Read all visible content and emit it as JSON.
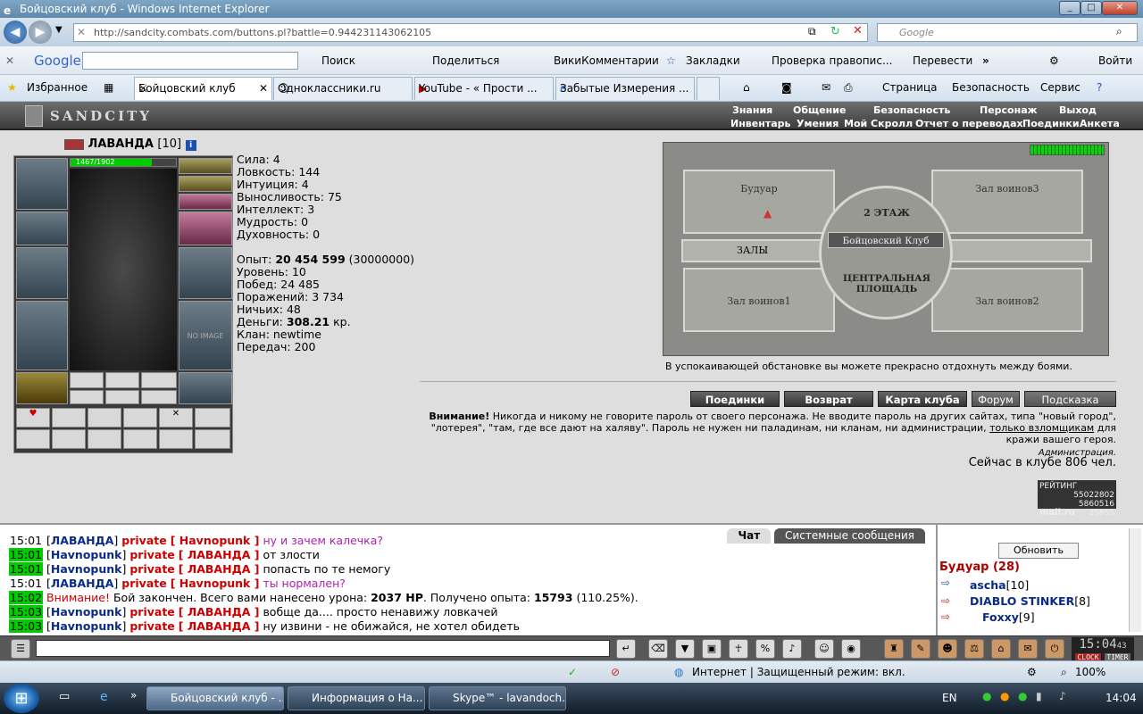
{
  "window": {
    "title": "Бойцовский клуб - Windows Internet Explorer"
  },
  "address": {
    "url": "http://sandcity.combats.com/buttons.pl?battle=0.944231143062105",
    "search_placeholder": "Google"
  },
  "google_toolbar": {
    "logo": "Google",
    "search": "Поиск",
    "share": "Поделиться",
    "wiki": "ВикиКомментарии",
    "bookmarks": "Закладки",
    "spell": "Проверка правопис...",
    "translate": "Перевести",
    "login": "Войти"
  },
  "favorites": {
    "label": "Избранное",
    "tabs": [
      "Бойцовский клуб",
      "Одноклассники.ru",
      "YouTube - « Прости ...",
      "Забытые Измерения ..."
    ],
    "page": "Страница",
    "security": "Безопасность",
    "service": "Сервис"
  },
  "game_nav": {
    "logo": "SANDCITY",
    "top": [
      "Знания",
      "Общение",
      "Безопасность",
      "Персонаж",
      "Выход"
    ],
    "sub": [
      "Инвентарь",
      "Умения",
      "Мой Скролл",
      "Отчет о переводах",
      "Поединки",
      "Анкета"
    ]
  },
  "character": {
    "name": "ЛАВАНДА",
    "level": "[10]",
    "hp": "1467/1902",
    "no_image": "NO IMAGE",
    "stats": [
      {
        "label": "Сила:",
        "value": "4",
        "extra": ""
      },
      {
        "label": "Ловкость:",
        "value": "144",
        "extra": ""
      },
      {
        "label": "Интуиция:",
        "value": "4",
        "extra": ""
      },
      {
        "label": "Выносливость:",
        "value": "75",
        "extra": ""
      },
      {
        "label": "Интеллект:",
        "value": "3",
        "extra": ""
      },
      {
        "label": "Мудрость:",
        "value": "0",
        "extra": ""
      },
      {
        "label": "Духовность:",
        "value": "0",
        "extra": ""
      }
    ],
    "exp_label": "Опыт:",
    "exp_value": "20 454 599",
    "exp_next": "(30000000)",
    "level_label": "Уровень: 10",
    "wins": "Побед: 24 485",
    "losses": "Поражений: 3 734",
    "draws": "Ничьих: 48",
    "money_label": "Деньги:",
    "money_value": "308.21",
    "money_unit": "кр.",
    "clan": "Клан: newtime",
    "transfers": "Передач: 200"
  },
  "map": {
    "floor": "2 ЭТАЖ",
    "center": "Бойцовский Клуб",
    "square": "ЦЕНТРАЛЬНАЯ ПЛОЩАДЬ",
    "rooms": [
      "Будуар",
      "Зал воинов3",
      "ЗАЛЫ",
      "Зал воинов1",
      "Зал воинов2"
    ],
    "caption": "В успокаивающей обстановке вы можете прекрасно отдохнуть между боями."
  },
  "game_buttons": [
    "Поединки",
    "Возврат",
    "Карта клуба",
    "Форум",
    "Подсказка"
  ],
  "warning": {
    "title": "Внимание!",
    "text": "Никогда и никому не говорите пароль от своего персонажа. Не вводите пароль на других сайтах, типа \"новый город\", \"лотерея\", \"там, где все дают на халяву\". Пароль не нужен ни паладинам, ни кланам, ни администрации,",
    "link": "только взломщикам",
    "tail": "для кражи вашего героя.",
    "sign": "Администрация."
  },
  "online": "Сейчас в клубе 806 чел.",
  "rating": {
    "label": "РЕЙТИНГ",
    "n1": "55022802",
    "n2": "5860516",
    "n3": "25855",
    "brand": "mail.ru"
  },
  "chat": {
    "tabs": [
      "Чат",
      "Системные сообщения"
    ],
    "messages": [
      {
        "time": "15:01",
        "hl": false,
        "from": "ЛАВАНДА",
        "to": "Havnopunk",
        "text": "ну и зачем калечка?",
        "pink": true
      },
      {
        "time": "15:01",
        "hl": true,
        "from": "Havnopunk",
        "to": "ЛАВАНДА",
        "text": "от злости",
        "pink": false
      },
      {
        "time": "15:01",
        "hl": true,
        "from": "Havnopunk",
        "to": "ЛАВАНДА",
        "text": "попасть по те немогу",
        "pink": false
      },
      {
        "time": "15:01",
        "hl": false,
        "from": "ЛАВАНДА",
        "to": "Havnopunk",
        "text": "ты нормален?",
        "pink": true
      },
      {
        "time": "15:03",
        "hl": true,
        "from": "Havnopunk",
        "to": "ЛАВАНДА",
        "text": "вобще да.... просто ненавижу ловкачей",
        "pink": false
      },
      {
        "time": "15:03",
        "hl": true,
        "from": "Havnopunk",
        "to": "ЛАВАНДА",
        "text": "ну извини - не обижайся, не хотел обидеть",
        "pink": false
      }
    ],
    "system": {
      "time": "15:02",
      "label": "Внимание!",
      "text1": "Бой закончен. Всего вами нанесено урона:",
      "dmg": "2037 HP",
      "text2": ". Получено опыта:",
      "exp": "15793",
      "text3": "(110.25%)."
    },
    "private_word": "private"
  },
  "sidebar": {
    "refresh": "Обновить",
    "room": "Будуар (28)",
    "players": [
      {
        "name": "ascha",
        "lvl": "[10]"
      },
      {
        "name": "DIABLO STINKER",
        "lvl": "[8]"
      },
      {
        "name": "Foxxy",
        "lvl": "[9]"
      }
    ]
  },
  "clock": {
    "time": "15:04",
    "sec": "43",
    "labels": [
      "CLOCK",
      "TIMER"
    ]
  },
  "status": {
    "zone": "Интернет | Защищенный режим: вкл.",
    "zoom": "100%"
  },
  "taskbar": {
    "items": [
      "Бойцовский клуб - ...",
      "Информация о На...",
      "Skype™ - lavandoch..."
    ],
    "lang": "EN",
    "time": "14:04"
  }
}
